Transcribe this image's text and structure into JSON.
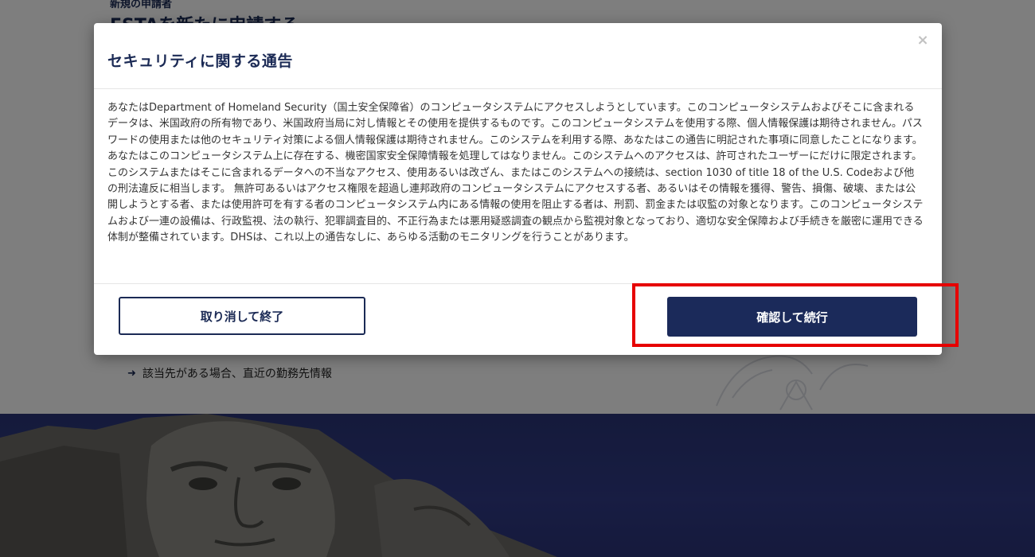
{
  "background": {
    "eyebrow": "新規の申請者",
    "title": "ESTAを新たに申請する",
    "link_arrow": "➜",
    "link_text": "該当先がある場合、直近の勤務先情報"
  },
  "modal": {
    "title": "セキュリティに関する通告",
    "close_symbol": "×",
    "body": "あなたはDepartment of Homeland Security（国土安全保障省）のコンピュータシステムにアクセスしようとしています。このコンピュータシステムおよびそこに含まれるデータは、米国政府の所有物であり、米国政府当局に対し情報とその使用を提供するものです。このコンピュータシステムを使用する際、個人情報保護は期待されません。パスワードの使用または他のセキュリティ対策による個人情報保護は期待されません。このシステムを利用する際、あなたはこの通告に明記された事項に同意したことになります。あなたはこのコンピュータシステム上に存在する、機密国家安全保障情報を処理してはなりません。このシステムへのアクセスは、許可されたユーザーにだけに限定されます。このシステムまたはそこに含まれるデータへの不当なアクセス、使用あるいは改ざん、またはこのシステムへの接続は、section 1030 of title 18 of the U.S. Codeおよび他の刑法違反に相当します。 無許可あるいはアクセス権限を超過し連邦政府のコンピュータシステムにアクセスする者、あるいはその情報を獲得、警告、損傷、破壊、または公開しようとする者、または使用許可を有する者のコンピュータシステム内にある情報の使用を阻止する者は、刑罰、罰金または収監の対象となります。このコンピュータシステムおよび一連の設備は、行政監視、法の執行、犯罪調査目的、不正行為または悪用疑惑調査の観点から監視対象となっており、適切な安全保障および手続きを厳密に運用できる体制が整備されています。DHSは、これ以上の通告なしに、あらゆる活動のモニタリングを行うことがあります。",
    "cancel_label": "取り消して終了",
    "confirm_label": "確認して続行"
  },
  "colors": {
    "brand_navy": "#1b2a5a",
    "highlight_red": "#e60000",
    "hero_blue": "#2f3a84"
  }
}
